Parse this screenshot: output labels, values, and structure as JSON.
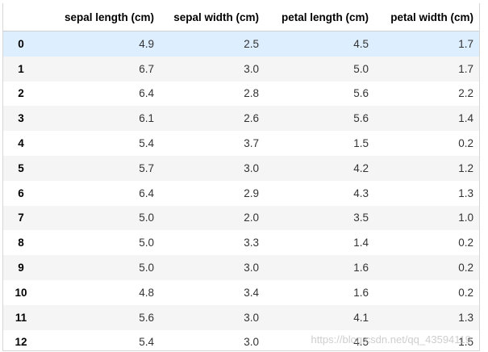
{
  "table": {
    "columns": [
      "sepal length (cm)",
      "sepal width (cm)",
      "petal length (cm)",
      "petal width (cm)"
    ],
    "rows": [
      {
        "index": "0",
        "values": [
          "4.9",
          "2.5",
          "4.5",
          "1.7"
        ]
      },
      {
        "index": "1",
        "values": [
          "6.7",
          "3.0",
          "5.0",
          "1.7"
        ]
      },
      {
        "index": "2",
        "values": [
          "6.4",
          "2.8",
          "5.6",
          "2.2"
        ]
      },
      {
        "index": "3",
        "values": [
          "6.1",
          "2.6",
          "5.6",
          "1.4"
        ]
      },
      {
        "index": "4",
        "values": [
          "5.4",
          "3.7",
          "1.5",
          "0.2"
        ]
      },
      {
        "index": "5",
        "values": [
          "5.7",
          "3.0",
          "4.2",
          "1.2"
        ]
      },
      {
        "index": "6",
        "values": [
          "6.4",
          "2.9",
          "4.3",
          "1.3"
        ]
      },
      {
        "index": "7",
        "values": [
          "5.0",
          "2.0",
          "3.5",
          "1.0"
        ]
      },
      {
        "index": "8",
        "values": [
          "5.0",
          "3.3",
          "1.4",
          "0.2"
        ]
      },
      {
        "index": "9",
        "values": [
          "5.0",
          "3.0",
          "1.6",
          "0.2"
        ]
      },
      {
        "index": "10",
        "values": [
          "4.8",
          "3.4",
          "1.6",
          "0.2"
        ]
      },
      {
        "index": "11",
        "values": [
          "5.6",
          "3.0",
          "4.1",
          "1.3"
        ]
      },
      {
        "index": "12",
        "values": [
          "5.4",
          "3.0",
          "4.5",
          "1.5"
        ]
      }
    ],
    "highlight_color": "#ddeeff",
    "stripe_color": "#f5f5f5"
  },
  "watermark": "https://blog.csdn.net/qq_43594119"
}
